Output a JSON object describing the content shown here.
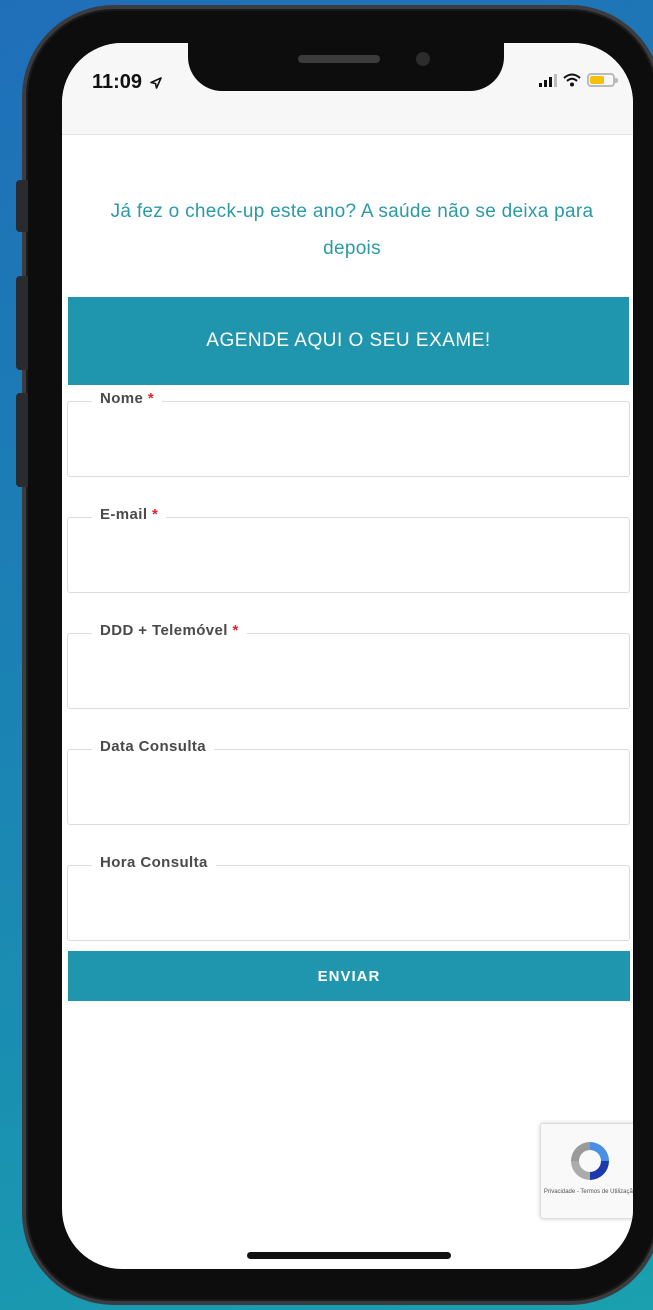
{
  "status_bar": {
    "time": "11:09",
    "location_icon": "location-arrow-icon",
    "battery_color": "#f4c20d"
  },
  "headline": "Já fez o check-up este ano? A saúde não se deixa para depois",
  "banner": "AGENDE AQUI O SEU EXAME!",
  "form": {
    "fields": [
      {
        "label": "Nome",
        "required_mark": "*"
      },
      {
        "label": "E-mail",
        "required_mark": "*"
      },
      {
        "label": "DDD + Telemóvel",
        "required_mark": "*"
      },
      {
        "label": "Data Consulta",
        "required_mark": ""
      },
      {
        "label": "Hora Consulta",
        "required_mark": ""
      }
    ],
    "submit_label": "ENVIAR"
  },
  "recaptcha": {
    "text": "Privacidade - Termos de Utilização"
  },
  "colors": {
    "accent": "#1f96ae",
    "headline": "#2a9aa8",
    "required": "#e0242a"
  }
}
